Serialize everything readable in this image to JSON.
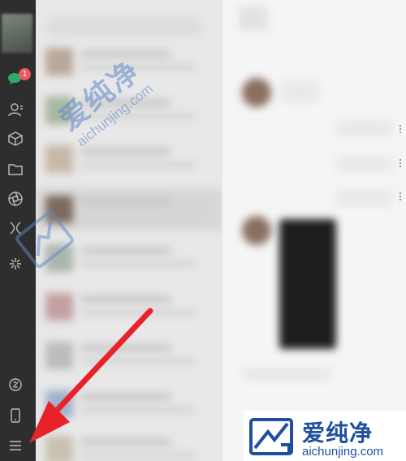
{
  "sidebar": {
    "unread_badge": "1",
    "icons": [
      "chat-icon",
      "contacts-icon",
      "cube-icon",
      "folder-icon",
      "moments-icon",
      "search-icon",
      "mini-program-icon",
      "link-icon",
      "phone-icon",
      "menu-icon"
    ]
  },
  "watermark": {
    "cn": "爱纯净",
    "en": "aichunjing.com"
  },
  "colors": {
    "sidebar": "#2e2e2e",
    "badge": "#f2575f",
    "chat_green": "#2aae67",
    "arrow": "#e8222b",
    "watermark_blue": "#1f4f9e"
  }
}
